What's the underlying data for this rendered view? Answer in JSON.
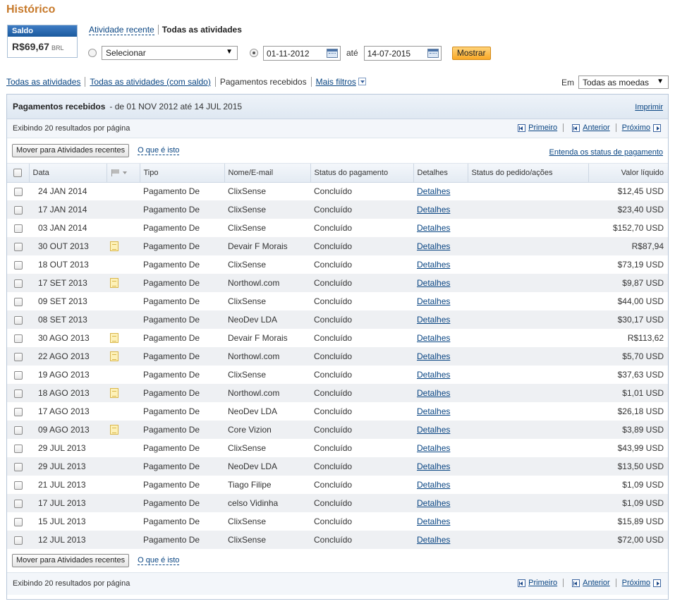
{
  "page": {
    "title": "Histórico"
  },
  "saldo": {
    "label": "Saldo",
    "amount": "R$69,67",
    "currency": "BRL"
  },
  "view": {
    "recent": "Atividade recente",
    "all": "Todas as atividades"
  },
  "filter": {
    "select_value": "Selecionar",
    "date_from": "01-11-2012",
    "ate": "até",
    "date_to": "14-07-2015",
    "show_button": "Mostrar"
  },
  "filters": {
    "all": "Todas as atividades",
    "all_balance": "Todas as atividades (com saldo)",
    "received": "Pagamentos recebidos",
    "more": "Mais filtros"
  },
  "currency": {
    "label": "Em",
    "value": "Todas as moedas"
  },
  "panel": {
    "title": "Pagamentos recebidos",
    "range": "- de 01 NOV 2012 até 14 JUL 2015",
    "print": "Imprimir",
    "showing": "Exibindo 20 resultados por página",
    "pager": {
      "first": "Primeiro",
      "prev": "Anterior",
      "next": "Próximo"
    },
    "move_button": "Mover para Atividades recentes",
    "what_is": "O que é isto",
    "understand": "Entenda os status de pagamento"
  },
  "table": {
    "headers": [
      "Data",
      "Tipo",
      "Nome/E-mail",
      "Status do pagamento",
      "Detalhes",
      "Status do pedido/ações",
      "Valor líquido"
    ],
    "rows": [
      {
        "date": "24 JAN 2014",
        "note": false,
        "type": "Pagamento De",
        "name": "ClixSense",
        "status": "Concluído",
        "details": "Detalhes",
        "value": "$12,45 USD"
      },
      {
        "date": "17 JAN 2014",
        "note": false,
        "type": "Pagamento De",
        "name": "ClixSense",
        "status": "Concluído",
        "details": "Detalhes",
        "value": "$23,40 USD"
      },
      {
        "date": "03 JAN 2014",
        "note": false,
        "type": "Pagamento De",
        "name": "ClixSense",
        "status": "Concluído",
        "details": "Detalhes",
        "value": "$152,70 USD"
      },
      {
        "date": "30 OUT 2013",
        "note": true,
        "type": "Pagamento De",
        "name": "Devair F Morais",
        "status": "Concluído",
        "details": "Detalhes",
        "value": "R$87,94"
      },
      {
        "date": "18 OUT 2013",
        "note": false,
        "type": "Pagamento De",
        "name": "ClixSense",
        "status": "Concluído",
        "details": "Detalhes",
        "value": "$73,19 USD"
      },
      {
        "date": "17 SET 2013",
        "note": true,
        "type": "Pagamento De",
        "name": "Northowl.com",
        "status": "Concluído",
        "details": "Detalhes",
        "value": "$9,87 USD"
      },
      {
        "date": "09 SET 2013",
        "note": false,
        "type": "Pagamento De",
        "name": "ClixSense",
        "status": "Concluído",
        "details": "Detalhes",
        "value": "$44,00 USD"
      },
      {
        "date": "08 SET 2013",
        "note": false,
        "type": "Pagamento De",
        "name": "NeoDev LDA",
        "status": "Concluído",
        "details": "Detalhes",
        "value": "$30,17 USD"
      },
      {
        "date": "30 AGO 2013",
        "note": true,
        "type": "Pagamento De",
        "name": "Devair F Morais",
        "status": "Concluído",
        "details": "Detalhes",
        "value": "R$113,62"
      },
      {
        "date": "22 AGO 2013",
        "note": true,
        "type": "Pagamento De",
        "name": "Northowl.com",
        "status": "Concluído",
        "details": "Detalhes",
        "value": "$5,70 USD"
      },
      {
        "date": "19 AGO 2013",
        "note": false,
        "type": "Pagamento De",
        "name": "ClixSense",
        "status": "Concluído",
        "details": "Detalhes",
        "value": "$37,63 USD"
      },
      {
        "date": "18 AGO 2013",
        "note": true,
        "type": "Pagamento De",
        "name": "Northowl.com",
        "status": "Concluído",
        "details": "Detalhes",
        "value": "$1,01 USD"
      },
      {
        "date": "17 AGO 2013",
        "note": false,
        "type": "Pagamento De",
        "name": "NeoDev LDA",
        "status": "Concluído",
        "details": "Detalhes",
        "value": "$26,18 USD"
      },
      {
        "date": "09 AGO 2013",
        "note": true,
        "type": "Pagamento De",
        "name": "Core Vizion",
        "status": "Concluído",
        "details": "Detalhes",
        "value": "$3,89 USD"
      },
      {
        "date": "29 JUL 2013",
        "note": false,
        "type": "Pagamento De",
        "name": "ClixSense",
        "status": "Concluído",
        "details": "Detalhes",
        "value": "$43,99 USD"
      },
      {
        "date": "29 JUL 2013",
        "note": false,
        "type": "Pagamento De",
        "name": "NeoDev LDA",
        "status": "Concluído",
        "details": "Detalhes",
        "value": "$13,50 USD"
      },
      {
        "date": "21 JUL 2013",
        "note": false,
        "type": "Pagamento De",
        "name": "Tiago Filipe",
        "status": "Concluído",
        "details": "Detalhes",
        "value": "$1,09 USD"
      },
      {
        "date": "17 JUL 2013",
        "note": false,
        "type": "Pagamento De",
        "name": "celso Vidinha",
        "status": "Concluído",
        "details": "Detalhes",
        "value": "$1,09 USD"
      },
      {
        "date": "15 JUL 2013",
        "note": false,
        "type": "Pagamento De",
        "name": "ClixSense",
        "status": "Concluído",
        "details": "Detalhes",
        "value": "$15,89 USD"
      },
      {
        "date": "12 JUL 2013",
        "note": false,
        "type": "Pagamento De",
        "name": "ClixSense",
        "status": "Concluído",
        "details": "Detalhes",
        "value": "$72,00 USD"
      }
    ]
  },
  "colors": {
    "title": "#c7792a",
    "link": "#084482",
    "show_button": "#f9a826"
  }
}
